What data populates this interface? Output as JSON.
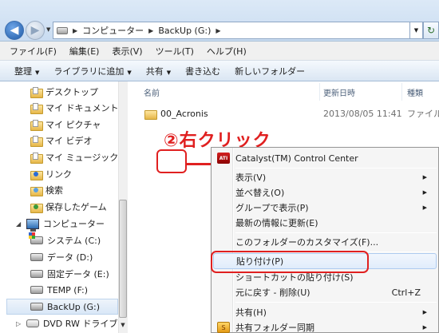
{
  "address_bar": {
    "path": [
      "コンピューター",
      "BackUp (G:)"
    ]
  },
  "menubar": {
    "items": [
      "ファイル(F)",
      "編集(E)",
      "表示(V)",
      "ツール(T)",
      "ヘルプ(H)"
    ]
  },
  "toolbar": {
    "organize": "整理",
    "add_to_library": "ライブラリに追加",
    "share": "共有",
    "burn": "書き込む",
    "new_folder": "新しいフォルダー"
  },
  "nav_pane": {
    "libraries": [
      "デスクトップ",
      "マイ ドキュメント",
      "マイ ピクチャ",
      "マイ ビデオ",
      "マイ ミュージック",
      "リンク",
      "検索",
      "保存したゲーム"
    ],
    "computer_label": "コンピューター",
    "drives": [
      "システム (C:)",
      "データ (D:)",
      "固定データ (E:)",
      "TEMP (F:)",
      "BackUp (G:)",
      "DVD RW ドライブ"
    ]
  },
  "file_list": {
    "columns": [
      "名前",
      "更新日時",
      "種類"
    ],
    "rows": [
      {
        "name": "00_Acronis",
        "modified": "2013/08/05 11:41",
        "type": "ファイル"
      }
    ]
  },
  "annotation": {
    "text": "②右クリック"
  },
  "context_menu": {
    "items": [
      {
        "label": "Catalyst(TM) Control Center",
        "icon": "ati-icon"
      },
      {
        "label": "表示(V)",
        "submenu": true
      },
      {
        "label": "並べ替え(O)",
        "submenu": true
      },
      {
        "label": "グループで表示(P)",
        "submenu": true
      },
      {
        "label": "最新の情報に更新(E)"
      },
      {
        "label": "このフォルダーのカスタマイズ(F)..."
      },
      {
        "label": "貼り付け(P)",
        "highlighted": true
      },
      {
        "label": "ショートカットの貼り付け(S)"
      },
      {
        "label": "元に戻す - 削除(U)",
        "shortcut": "Ctrl+Z"
      },
      {
        "label": "共有(H)",
        "submenu": true
      },
      {
        "label": "共有フォルダー同期",
        "submenu": true,
        "icon": "share-sync-icon"
      }
    ]
  },
  "colors": {
    "annotation_red": "#e02020",
    "accent_blue": "#1f5aa6"
  }
}
